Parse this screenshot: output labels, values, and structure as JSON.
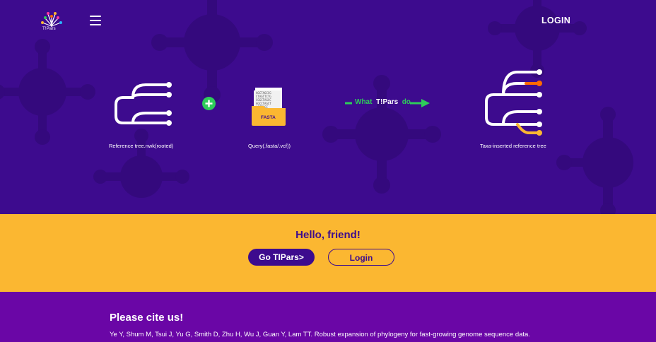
{
  "nav": {
    "logo_text": "T!Pars",
    "login_label": "LOGIN"
  },
  "workflow": {
    "reference_caption": "Reference tree.nwk(rooted)",
    "query_caption": "Query(.fasta/.vcf))",
    "fasta_label": "FASTA",
    "fasta_sequences": [
      "AGCTAGCCG",
      "CTAGTTCTG",
      "CGGCTAGCC",
      "AGCCTAGCT",
      "ACCTAGC"
    ],
    "arrow_text_before": "What",
    "arrow_text_brand": "T!Pars",
    "arrow_text_after": "do",
    "output_caption": "Taxa-inserted reference tree"
  },
  "hello": {
    "greeting": "Hello, friend!",
    "go_button": "Go TIPars>",
    "login_button": "Login"
  },
  "cite": {
    "title": "Please cite us!",
    "text": "Ye Y, Shum M, Tsui J, Yu G, Smith D, Zhu H, Wu J, Guan Y, Lam TT. Robust expansion of phylogeny for fast-growing genome sequence data."
  },
  "colors": {
    "hero_bg": "#3d0b8e",
    "accent_yellow": "#fbb731",
    "cite_bg": "#6a06a6",
    "green": "#2ecc5a",
    "orange": "#ff6a00"
  },
  "icons": [
    "logo-icon",
    "menu-icon",
    "tree-icon",
    "plus-icon",
    "folder-icon",
    "arrow-icon"
  ]
}
